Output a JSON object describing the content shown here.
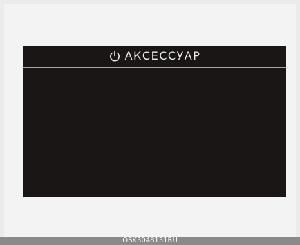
{
  "display": {
    "title": "АКСЕССУАР",
    "status_icon": "power-icon"
  },
  "footer": {
    "code": "OSK3048131RU"
  },
  "colors": {
    "screen_background": "#1a1616",
    "text": "#ededed",
    "divider": "#a8a4a4",
    "footer_bar": "#8a8a8a",
    "page_background": "#ebebeb"
  }
}
